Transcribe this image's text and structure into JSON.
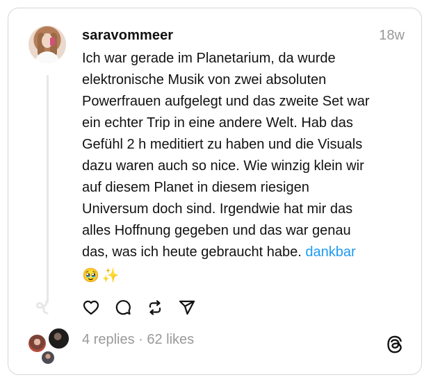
{
  "post": {
    "username": "saravommeer",
    "timestamp": "18w",
    "text": "Ich war gerade im Planetarium, da wurde\nelektronische Musik von zwei absoluten\nPowerfrauen aufgelegt und das zweite Set war\nein echter Trip in eine andere Welt. Hab das\nGefühl 2 h meditiert zu haben und die Visuals\ndazu waren auch so nice. Wie winzig klein wir\nauf diesem Planet in diesem riesigen\nUniversum doch sind. Irgendwie hat mir das\nalles Hoffnung gegeben und das war genau\ndas, was ich heute gebraucht habe. ",
    "tag": "dankbar",
    "emojis": [
      "🥹",
      "✨"
    ]
  },
  "actions": {
    "like_icon": "heart-icon",
    "comment_icon": "comment-icon",
    "repost_icon": "repost-icon",
    "share_icon": "send-icon"
  },
  "stats": {
    "text": "4 replies · 62 likes"
  },
  "colors": {
    "text": "#111111",
    "muted": "#999999",
    "tag": "#1d9bf0",
    "border": "#d6d6d6",
    "thread_line": "#e7e7e7"
  }
}
